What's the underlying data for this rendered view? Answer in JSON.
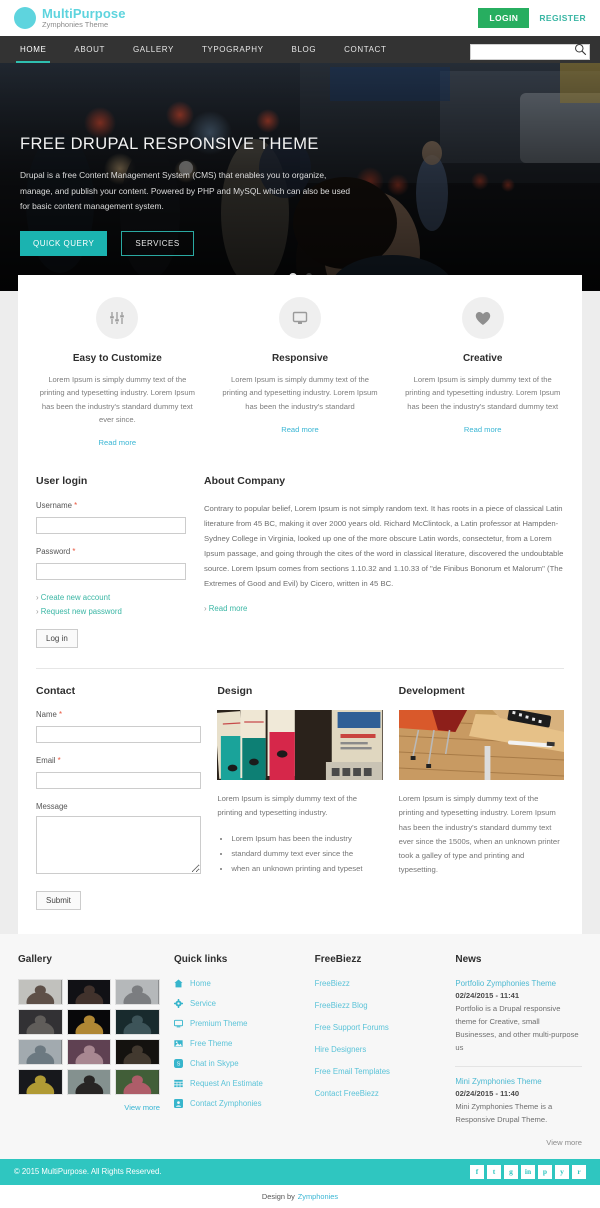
{
  "header": {
    "logo_title": "MultiPurpose",
    "logo_subtitle": "Zymphonies Theme",
    "login_label": "LOGIN",
    "register_label": "REGISTER",
    "accent_green": "#27ae60",
    "accent_teal": "#2fc6c0"
  },
  "nav": {
    "items": [
      {
        "label": "HOME",
        "active": true
      },
      {
        "label": "ABOUT",
        "active": false
      },
      {
        "label": "GALLERY",
        "active": false
      },
      {
        "label": "TYPOGRAPHY",
        "active": false
      },
      {
        "label": "BLOG",
        "active": false
      },
      {
        "label": "CONTACT",
        "active": false
      }
    ],
    "search_value": "",
    "search_placeholder": ""
  },
  "hero": {
    "title": "FREE DRUPAL RESPONSIVE THEME",
    "description": "Drupal is a free Content Management System (CMS) that enables you to organize, manage, and publish your content. Powered by PHP and MySQL which can also be used for basic content management system.",
    "primary_button": "QUICK QUERY",
    "secondary_button": "SERVICES",
    "slides": 2,
    "active_slide": 1
  },
  "features": [
    {
      "icon": "sliders-icon",
      "title": "Easy to Customize",
      "description": "Lorem Ipsum is simply dummy text of the printing and typesetting industry. Lorem Ipsum has been the industry's standard dummy text ever since.",
      "link": "Read more"
    },
    {
      "icon": "monitor-icon",
      "title": "Responsive",
      "description": "Lorem Ipsum is simply dummy text of the printing and typesetting industry. Lorem Ipsum has been the industry's standard",
      "link": "Read more"
    },
    {
      "icon": "heart-icon",
      "title": "Creative",
      "description": "Lorem Ipsum is simply dummy text of the printing and typesetting industry. Lorem Ipsum has been the industry's standard dummy text",
      "link": "Read more"
    }
  ],
  "login": {
    "title": "User login",
    "username_label": "Username",
    "username_value": "",
    "password_label": "Password",
    "password_value": "",
    "create_account": "Create new account",
    "request_password": "Request new password",
    "submit_label": "Log in"
  },
  "about": {
    "title": "About Company",
    "body": "Contrary to popular belief, Lorem Ipsum is not simply random text. It has roots in a piece of classical Latin literature from 45 BC, making it over 2000 years old. Richard McClintock, a Latin professor at Hampden-Sydney College in Virginia, looked up one of the more obscure Latin words, consectetur, from a Lorem Ipsum passage, and going through the cites of the word in classical literature, discovered the undoubtable source. Lorem Ipsum comes from sections 1.10.32 and 1.10.33 of \"de Finibus Bonorum et Malorum\" (The Extremes of Good and Evil) by Cicero, written in 45 BC.",
    "link": "Read more"
  },
  "contact": {
    "title": "Contact",
    "name_label": "Name",
    "name_value": "",
    "email_label": "Email",
    "email_value": "",
    "message_label": "Message",
    "message_value": "",
    "submit_label": "Submit"
  },
  "design": {
    "title": "Design",
    "image_alt": "binders-on-desk-photo",
    "body": "Lorem Ipsum is simply dummy text of the printing and typesetting industry.",
    "list": [
      "Lorem Ipsum has been the industry",
      "standard dummy text ever since the",
      "when an unknown printing and typeset"
    ]
  },
  "development": {
    "title": "Development",
    "image_alt": "desk-and-chair-photo",
    "body": "Lorem Ipsum is simply dummy text of the printing and typesetting industry. Lorem Ipsum has been the industry's standard dummy text ever since the 1500s, when an unknown printer took a galley of type and printing and typesetting."
  },
  "footer": {
    "gallery": {
      "title": "Gallery",
      "view_more": "View more",
      "thumbs": [
        {
          "alt": "woman-at-desk",
          "c1": "#dcdcd8",
          "c2": "#6b5c52"
        },
        {
          "alt": "woman-in-black-dress",
          "c1": "#141418",
          "c2": "#4a3a33"
        },
        {
          "alt": "blonde-portrait",
          "c1": "#cfd2d4",
          "c2": "#8c8f92"
        },
        {
          "alt": "man-portrait-grey",
          "c1": "#39383c",
          "c2": "#6e6a67"
        },
        {
          "alt": "hands-with-light",
          "c1": "#0a0a0c",
          "c2": "#c99a3c"
        },
        {
          "alt": "man-with-bokeh",
          "c1": "#1c3034",
          "c2": "#466066"
        },
        {
          "alt": "group-of-friends",
          "c1": "#b9c2c8",
          "c2": "#7c8a93"
        },
        {
          "alt": "woman-purple-light",
          "c1": "#6d4b5e",
          "c2": "#c09aa6"
        },
        {
          "alt": "man-arms-crossed",
          "c1": "#171512",
          "c2": "#4c4136"
        },
        {
          "alt": "man-yellow-shirt",
          "c1": "#1b1c20",
          "c2": "#c9b03c"
        },
        {
          "alt": "woman-with-bottle",
          "c1": "#97a6a3",
          "c2": "#2d2b2a"
        },
        {
          "alt": "woman-floral-dress",
          "c1": "#4a6b40",
          "c2": "#c66a78"
        }
      ]
    },
    "quick_links": {
      "title": "Quick links",
      "items": [
        {
          "label": "Home",
          "icon": "home-icon"
        },
        {
          "label": "Service",
          "icon": "gear-icon"
        },
        {
          "label": "Premium Theme",
          "icon": "monitor-icon"
        },
        {
          "label": "Free Theme",
          "icon": "image-icon"
        },
        {
          "label": "Chat in Skype",
          "icon": "skype-icon"
        },
        {
          "label": "Request An Estimate",
          "icon": "grid-icon"
        },
        {
          "label": "Contact Zymphonies",
          "icon": "contact-icon"
        }
      ]
    },
    "freebiezz": {
      "title": "FreeBiezz",
      "items": [
        "FreeBiezz",
        "FreeBiezz Blog",
        "Free Support Forums",
        "Hire Designers",
        "Free Email Templates",
        "Contact FreeBiezz"
      ]
    },
    "news": {
      "title": "News",
      "view_more": "View more",
      "items": [
        {
          "title": "Portfolio Zymphonies Theme",
          "date": "02/24/2015 - 11:41",
          "body": "Portfolio is a Drupal responsive theme for Creative, small Businesses, and other multi-purpose us"
        },
        {
          "title": "Mini Zymphonies Theme",
          "date": "02/24/2015 - 11:40",
          "body": "Mini Zymphonies Theme is a Responsive Drupal Theme."
        }
      ]
    }
  },
  "bottom": {
    "copyright": "© 2015 MultiPurpose. All Rights Reserved.",
    "socials": [
      {
        "name": "facebook-icon",
        "glyph": "f"
      },
      {
        "name": "twitter-icon",
        "glyph": "t"
      },
      {
        "name": "google-plus-icon",
        "glyph": "g"
      },
      {
        "name": "linkedin-icon",
        "glyph": "in"
      },
      {
        "name": "pinterest-icon",
        "glyph": "p"
      },
      {
        "name": "youtube-icon",
        "glyph": "y"
      },
      {
        "name": "rss-icon",
        "glyph": "r"
      }
    ],
    "design_by_prefix": "Design by",
    "design_by_link": "Zymphonies"
  }
}
